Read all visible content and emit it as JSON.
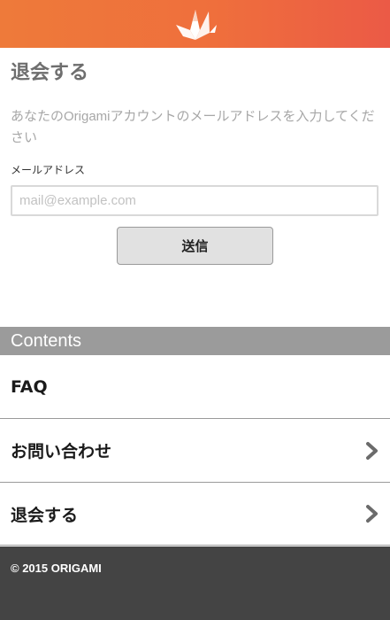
{
  "header": {
    "logo_icon": "origami-crane-icon",
    "gradient_start": "#ee7a3a",
    "gradient_end": "#eb5a46"
  },
  "withdraw": {
    "title": "退会する",
    "description": "あなたのOrigamiアカウントのメールアドレスを入力してください",
    "email_label": "メールアドレス",
    "email_value": "",
    "email_placeholder": "mail@example.com",
    "submit_label": "送信"
  },
  "contents": {
    "header": "Contents",
    "items": [
      {
        "label": "FAQ",
        "has_chevron": false
      },
      {
        "label": "お問い合わせ",
        "has_chevron": true,
        "icon": "chevron-right-icon"
      },
      {
        "label": "退会する",
        "has_chevron": true,
        "icon": "chevron-right-icon"
      }
    ]
  },
  "footer": {
    "copyright": "© 2015 ORIGAMI"
  }
}
